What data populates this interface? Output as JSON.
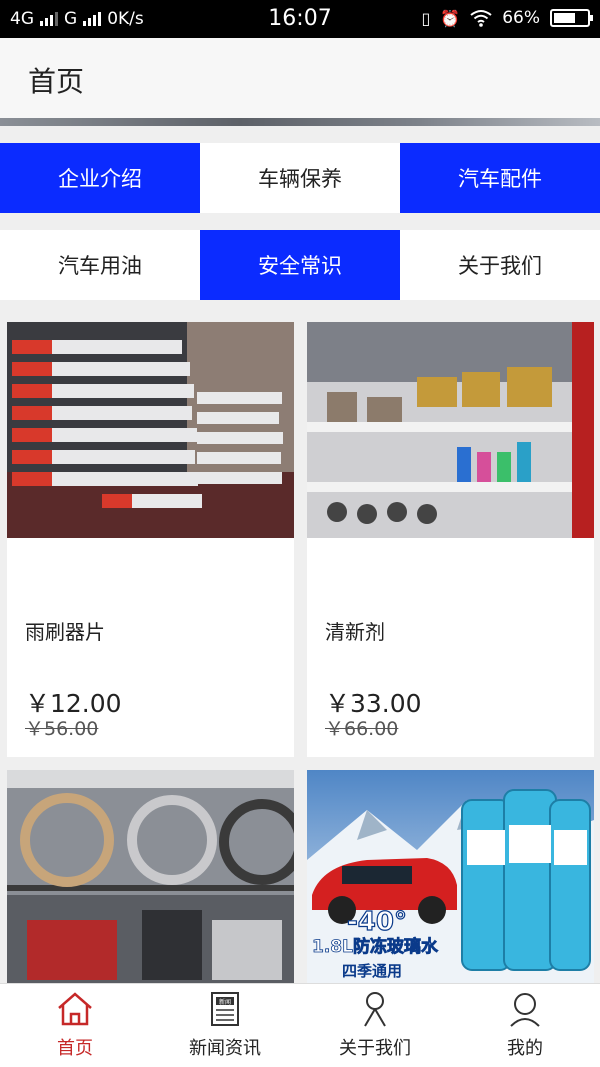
{
  "status": {
    "network1": "4G",
    "network2": "G",
    "speed": "0K/s",
    "time": "16:07",
    "battery": "66%",
    "battery_level": 0.66
  },
  "header": {
    "title": "首页"
  },
  "nav": {
    "row1": [
      {
        "label": "企业介绍",
        "active": true
      },
      {
        "label": "车辆保养",
        "active": false
      },
      {
        "label": "汽车配件",
        "active": true
      }
    ],
    "row2": [
      {
        "label": "汽车用油",
        "active": false
      },
      {
        "label": "安全常识",
        "active": true
      },
      {
        "label": "关于我们",
        "active": false
      }
    ]
  },
  "products": [
    {
      "name": "雨刷器片",
      "price": "￥12.00",
      "old_price": "￥56.00"
    },
    {
      "name": "清新剂",
      "price": "￥33.00",
      "old_price": "￥66.00"
    },
    {
      "name": "",
      "price": "",
      "old_price": ""
    },
    {
      "name": "",
      "price": "",
      "old_price": "",
      "image_text": {
        "temp": "-40°",
        "line1": "1.8L防冻玻璃水",
        "line2": "四季通用"
      }
    }
  ],
  "tabbar": [
    {
      "label": "首页",
      "icon": "home-icon",
      "active": true
    },
    {
      "label": "新闻资讯",
      "icon": "news-icon",
      "active": false,
      "icon_text": "新闻"
    },
    {
      "label": "关于我们",
      "icon": "person-icon",
      "active": false
    },
    {
      "label": "我的",
      "icon": "user-icon",
      "active": false
    }
  ],
  "colors": {
    "accent": "#0b2bff",
    "active_tab": "#c62828"
  }
}
